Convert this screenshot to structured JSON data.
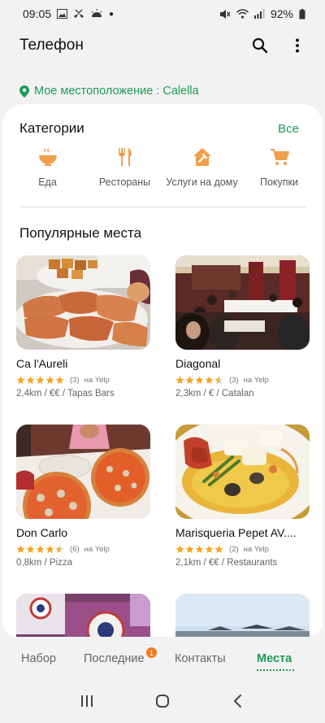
{
  "status_bar": {
    "time": "09:05",
    "battery": "92%",
    "icons": [
      "gallery-icon",
      "missed-call-icon",
      "weather-icon",
      "dot-icon",
      "mute-icon",
      "wifi-icon",
      "signal-icon",
      "battery-icon"
    ]
  },
  "app_bar": {
    "title": "Телефон",
    "icons": [
      "search-icon",
      "more-vert-icon"
    ]
  },
  "location": {
    "label": "Мое местоположение : Calella",
    "icon": "location-pin-icon"
  },
  "categories": {
    "title": "Категории",
    "see_all": "Все",
    "items": [
      {
        "label": "Еда",
        "icon": "food-bowl-icon"
      },
      {
        "label": "Рестораны",
        "icon": "fork-knife-icon"
      },
      {
        "label": "Услуги на дому",
        "icon": "home-service-icon"
      },
      {
        "label": "Покупки",
        "icon": "shopping-cart-icon"
      }
    ]
  },
  "popular": {
    "title": "Популярные места",
    "places": [
      {
        "name": "Ca l'Aureli",
        "rating": 5,
        "count": "(3)",
        "source": "на Yelp",
        "meta": "2,4km / €€ / Tapas Bars",
        "image": "food-tapas"
      },
      {
        "name": "Diagonal",
        "rating": 4.5,
        "count": "(3)",
        "source": "на Yelp",
        "meta": "2,3km / € / Catalan",
        "image": "restaurant-interior"
      },
      {
        "name": "Don Carlo",
        "rating": 4.5,
        "count": "(6)",
        "source": "на Yelp",
        "meta": "0,8km / Pizza",
        "image": "pizza"
      },
      {
        "name": "Marisqueria Pepet AV....",
        "rating": 5,
        "count": "(2)",
        "source": "на Yelp",
        "meta": "2,1km / €€ / Restaurants",
        "image": "seafood-dish"
      },
      {
        "name": "",
        "image": "pizza-box"
      },
      {
        "name": "",
        "image": "beach-terrace"
      }
    ]
  },
  "tabs": {
    "items": [
      "Набор",
      "Последние",
      "Контакты",
      "Места"
    ],
    "active": "Места",
    "recent_badge": "1"
  },
  "nav_bar": {
    "icons": [
      "recents-icon",
      "home-icon",
      "back-icon"
    ]
  },
  "colors": {
    "accent": "#1e9a57",
    "category_icon": "#f0a04b",
    "star": "#f5a623",
    "badge": "#f07a22"
  }
}
